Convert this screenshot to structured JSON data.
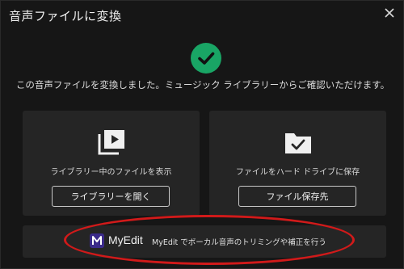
{
  "dialog": {
    "title": "音声ファイルに変換",
    "message": "この音声ファイルを変換しました。ミュージック ライブラリーからご確認いただけます。"
  },
  "cards": {
    "library": {
      "label": "ライブラリー中のファイルを表示",
      "button": "ライブラリーを開く",
      "icon": "play-library-icon"
    },
    "save": {
      "label": "ファイルをハード ドライブに保存",
      "button": "ファイル保存先",
      "icon": "folder-check-icon"
    }
  },
  "promo": {
    "brand": "MyEdit",
    "description": "MyEdit でボーカル音声のトリミングや補正を行う",
    "icon": "myedit-logo-icon"
  },
  "colors": {
    "success": "#19a565",
    "highlight": "#d11a1a",
    "card_bg": "#252525",
    "background": "#161616"
  }
}
